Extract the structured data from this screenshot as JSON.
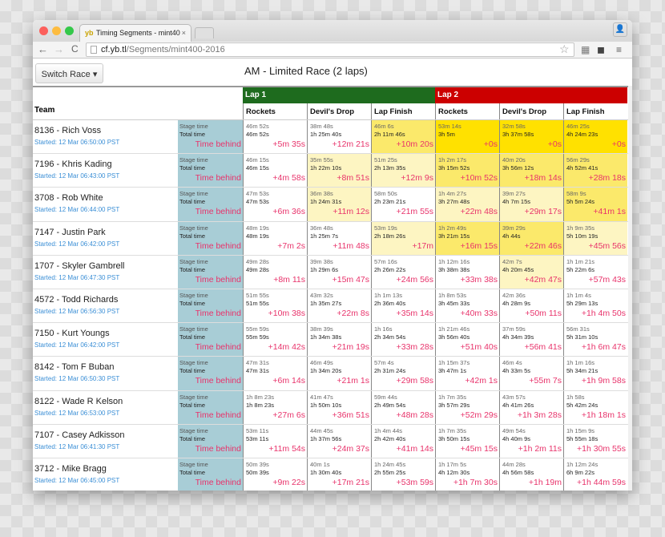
{
  "browser": {
    "tab_title": "Timing Segments - mint40",
    "tab_logo": "yb",
    "url_domain": "cf.yb.tl",
    "url_path": "/Segments/mint400-2016"
  },
  "page": {
    "switch_label": "Switch Race ▾",
    "title": "AM - Limited Race (2 laps)"
  },
  "table": {
    "team_header": "Team",
    "laps": [
      {
        "label": "Lap 1",
        "color": "#1e6b1e"
      },
      {
        "label": "Lap 2",
        "color": "#cc0000"
      }
    ],
    "columns": [
      "Rockets",
      "Devil's Drop",
      "Lap Finish",
      "Rockets",
      "Devil's Drop",
      "Lap Finish"
    ],
    "row_labels": {
      "stage": "Stage time",
      "total": "Total time",
      "behind": "Time behind"
    },
    "shade_colors": [
      "#ffffff",
      "#fdf5c2",
      "#fbe96b",
      "#ffe100"
    ],
    "rows": [
      {
        "team": "8136 - Rich Voss",
        "started": "Started: 12 Mar 06:50:00 PST",
        "cells": [
          [
            "46m 52s",
            "46m 52s",
            "+5m 35s",
            0
          ],
          [
            "38m 48s",
            "1h 25m 40s",
            "+12m 21s",
            0
          ],
          [
            "46m 6s",
            "2h 11m 46s",
            "+10m 20s",
            2
          ],
          [
            "53m 14s",
            "3h 5m",
            "+0s",
            3
          ],
          [
            "32m 58s",
            "3h 37m 58s",
            "+0s",
            3
          ],
          [
            "46m 25s",
            "4h 24m 23s",
            "+0s",
            3
          ]
        ]
      },
      {
        "team": "7196 - Khris Kading",
        "started": "Started: 12 Mar 06:43:00 PST",
        "cells": [
          [
            "46m 15s",
            "46m 15s",
            "+4m 58s",
            0
          ],
          [
            "35m 55s",
            "1h 22m 10s",
            "+8m 51s",
            1
          ],
          [
            "51m 25s",
            "2h 13m 35s",
            "+12m 9s",
            1
          ],
          [
            "1h 2m 17s",
            "3h 15m 52s",
            "+10m 52s",
            2
          ],
          [
            "40m 20s",
            "3h 56m 12s",
            "+18m 14s",
            2
          ],
          [
            "56m 29s",
            "4h 52m 41s",
            "+28m 18s",
            2
          ]
        ]
      },
      {
        "team": "3708 - Rob White",
        "started": "Started: 12 Mar 06:44:00 PST",
        "cells": [
          [
            "47m 53s",
            "47m 53s",
            "+6m 36s",
            0
          ],
          [
            "36m 38s",
            "1h 24m 31s",
            "+11m 12s",
            1
          ],
          [
            "58m 50s",
            "2h 23m 21s",
            "+21m 55s",
            0
          ],
          [
            "1h 4m 27s",
            "3h 27m 48s",
            "+22m 48s",
            1
          ],
          [
            "39m 27s",
            "4h 7m 15s",
            "+29m 17s",
            1
          ],
          [
            "58m 9s",
            "5h 5m 24s",
            "+41m 1s",
            2
          ]
        ]
      },
      {
        "team": "7147 - Justin Park",
        "started": "Started: 12 Mar 06:42:00 PST",
        "cells": [
          [
            "48m 19s",
            "48m 19s",
            "+7m 2s",
            0
          ],
          [
            "36m 48s",
            "1h 25m 7s",
            "+11m 48s",
            0
          ],
          [
            "53m 19s",
            "2h 18m 26s",
            "+17m",
            1
          ],
          [
            "1h 2m 49s",
            "3h 21m 15s",
            "+16m 15s",
            2
          ],
          [
            "39m 29s",
            "4h 44s",
            "+22m 46s",
            2
          ],
          [
            "1h 9m 35s",
            "5h 10m 19s",
            "+45m 56s",
            1
          ]
        ]
      },
      {
        "team": "1707 - Skyler Gambrell",
        "started": "Started: 12 Mar 06:47:30 PST",
        "cells": [
          [
            "49m 28s",
            "49m 28s",
            "+8m 11s",
            0
          ],
          [
            "39m 38s",
            "1h 29m 6s",
            "+15m 47s",
            0
          ],
          [
            "57m 16s",
            "2h 26m 22s",
            "+24m 56s",
            0
          ],
          [
            "1h 12m 16s",
            "3h 38m 38s",
            "+33m 38s",
            0
          ],
          [
            "42m 7s",
            "4h 20m 45s",
            "+42m 47s",
            1
          ],
          [
            "1h 1m 21s",
            "5h 22m 6s",
            "+57m 43s",
            0
          ]
        ]
      },
      {
        "team": "4572 - Todd Richards",
        "started": "Started: 12 Mar 06:56:30 PST",
        "cells": [
          [
            "51m 55s",
            "51m 55s",
            "+10m 38s",
            0
          ],
          [
            "43m 32s",
            "1h 35m 27s",
            "+22m 8s",
            0
          ],
          [
            "1h 1m 13s",
            "2h 36m 40s",
            "+35m 14s",
            0
          ],
          [
            "1h 8m 53s",
            "3h 45m 33s",
            "+40m 33s",
            0
          ],
          [
            "42m 36s",
            "4h 28m 9s",
            "+50m 11s",
            0
          ],
          [
            "1h 1m 4s",
            "5h 29m 13s",
            "+1h 4m 50s",
            0
          ]
        ]
      },
      {
        "team": "7150 - Kurt Youngs",
        "started": "Started: 12 Mar 06:42:00 PST",
        "cells": [
          [
            "55m 59s",
            "55m 59s",
            "+14m 42s",
            0
          ],
          [
            "38m 39s",
            "1h 34m 38s",
            "+21m 19s",
            0
          ],
          [
            "1h 16s",
            "2h 34m 54s",
            "+33m 28s",
            0
          ],
          [
            "1h 21m 46s",
            "3h 56m 40s",
            "+51m 40s",
            0
          ],
          [
            "37m 59s",
            "4h 34m 39s",
            "+56m 41s",
            0
          ],
          [
            "56m 31s",
            "5h 31m 10s",
            "+1h 6m 47s",
            0
          ]
        ]
      },
      {
        "team": "8142 - Tom F Buban",
        "started": "Started: 12 Mar 06:50:30 PST",
        "cells": [
          [
            "47m 31s",
            "47m 31s",
            "+6m 14s",
            0
          ],
          [
            "46m 49s",
            "1h 34m 20s",
            "+21m 1s",
            0
          ],
          [
            "57m 4s",
            "2h 31m 24s",
            "+29m 58s",
            0
          ],
          [
            "1h 15m 37s",
            "3h 47m 1s",
            "+42m 1s",
            0
          ],
          [
            "46m 4s",
            "4h 33m 5s",
            "+55m 7s",
            0
          ],
          [
            "1h 1m 16s",
            "5h 34m 21s",
            "+1h 9m 58s",
            0
          ]
        ]
      },
      {
        "team": "8122 - Wade R Kelson",
        "started": "Started: 12 Mar 06:53:00 PST",
        "cells": [
          [
            "1h 8m 23s",
            "1h 8m 23s",
            "+27m 6s",
            0
          ],
          [
            "41m 47s",
            "1h 50m 10s",
            "+36m 51s",
            0
          ],
          [
            "59m 44s",
            "2h 49m 54s",
            "+48m 28s",
            0
          ],
          [
            "1h 7m 35s",
            "3h 57m 29s",
            "+52m 29s",
            0
          ],
          [
            "43m 57s",
            "4h 41m 26s",
            "+1h 3m 28s",
            0
          ],
          [
            "1h 58s",
            "5h 42m 24s",
            "+1h 18m 1s",
            0
          ]
        ]
      },
      {
        "team": "7107 - Casey Adkisson",
        "started": "Started: 12 Mar 06:41:30 PST",
        "cells": [
          [
            "53m 11s",
            "53m 11s",
            "+11m 54s",
            0
          ],
          [
            "44m 45s",
            "1h 37m 56s",
            "+24m 37s",
            0
          ],
          [
            "1h 4m 44s",
            "2h 42m 40s",
            "+41m 14s",
            0
          ],
          [
            "1h 7m 35s",
            "3h 50m 15s",
            "+45m 15s",
            0
          ],
          [
            "49m 54s",
            "4h 40m 9s",
            "+1h 2m 11s",
            0
          ],
          [
            "1h 15m 9s",
            "5h 55m 18s",
            "+1h 30m 55s",
            0
          ]
        ]
      },
      {
        "team": "3712 - Mike Bragg",
        "started": "Started: 12 Mar 06:45:00 PST",
        "cells": [
          [
            "50m 39s",
            "50m 39s",
            "+9m 22s",
            0
          ],
          [
            "40m 1s",
            "1h 30m 40s",
            "+17m 21s",
            0
          ],
          [
            "1h 24m 45s",
            "2h 55m 25s",
            "+53m 59s",
            0
          ],
          [
            "1h 17m 5s",
            "4h 12m 30s",
            "+1h 7m 30s",
            0
          ],
          [
            "44m 28s",
            "4h 56m 58s",
            "+1h 19m",
            0
          ],
          [
            "1h 12m 24s",
            "6h 9m 22s",
            "+1h 44m 59s",
            0
          ]
        ]
      }
    ]
  }
}
